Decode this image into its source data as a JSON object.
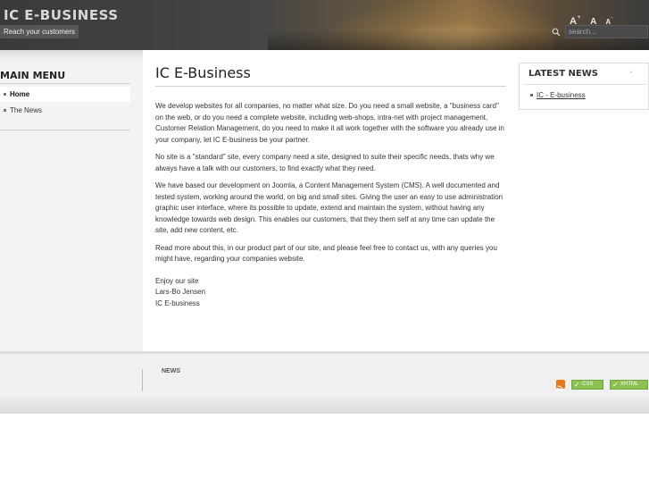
{
  "header": {
    "site_title": "IC E-BUSINESS",
    "tagline": "Reach your customers",
    "font_tools": {
      "increase": "A",
      "reset": "A",
      "decrease": "A"
    },
    "search_placeholder": "search..."
  },
  "sidebar": {
    "title": "MAIN MENU",
    "items": [
      {
        "label": "Home",
        "active": true
      },
      {
        "label": "The News",
        "active": false
      }
    ]
  },
  "main": {
    "title": "IC E-Business",
    "paragraphs": [
      "We develop websites for all companies, no matter what size. Do you need a small website, a \"business card\" on the web, or do you need a complete website, including web-shops, intra-net with project management, Customer Relation Management, do you need to make it all work together with the software you already use in your company, let IC E-business be your partner.",
      "No site is a \"standard\" site, every company need a site, designed to suite their specific needs, thats why we always have a talk with our customers, to find exactly what they need.",
      "We have based our development on Joomla, a Content Management System (CMS). A well documented and tested system, working around the world, on big and small sites. Giving the user an easy to use administration graphic user interface, where its possible to update, extend and maintain the system, without having any knowledge towards web design. This enables our customers, that they them self at any time can update the site, add new content, etc.",
      "Read more about this, in our product part of our site, and please feel free to contact us, with any queries you might have, regarding your companies website."
    ],
    "signature": [
      "Enjoy our site",
      "Lars-Bo Jensen",
      "IC E-business"
    ]
  },
  "latest_news": {
    "title": "LATEST NEWS",
    "collapse_glyph": "˄",
    "items": [
      "IC - E-business"
    ]
  },
  "footer": {
    "label": "NEWS",
    "badges": {
      "css": "CSS",
      "xhtml": "XHTML"
    }
  },
  "colors": {
    "header_bg": "#3a3a3a",
    "sidebar_bg": "#f3f3f3",
    "badge_green": "#8cc152",
    "rss_orange": "#e8791c"
  }
}
